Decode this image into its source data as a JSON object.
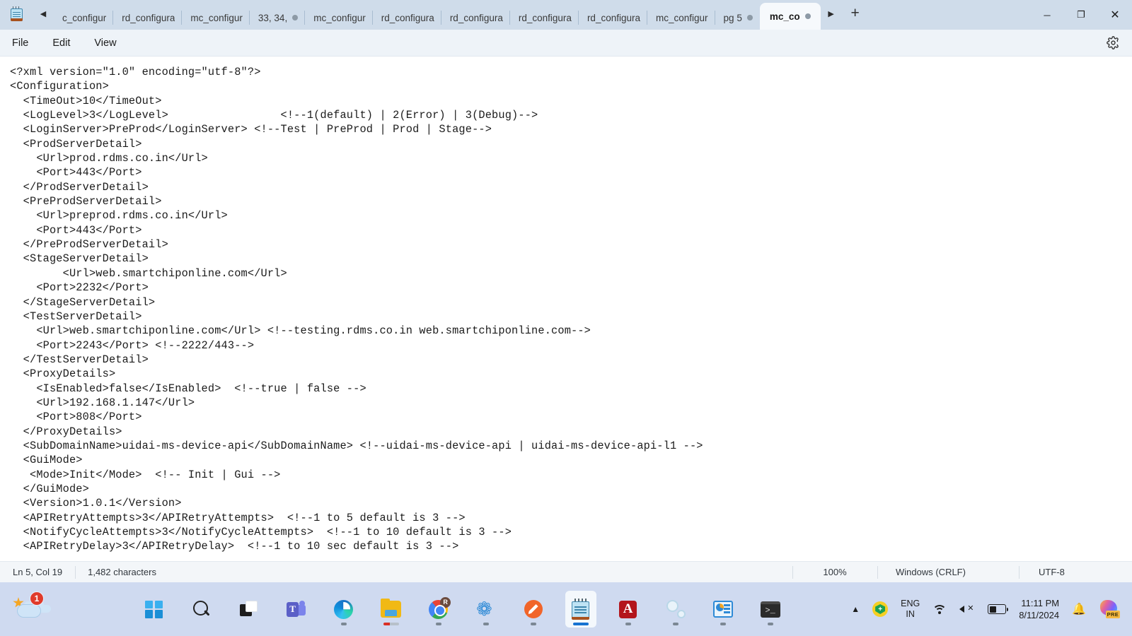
{
  "window": {
    "app_icon": "notepad-icon",
    "tabs": [
      {
        "label": "c_configur",
        "dot": false,
        "active": false
      },
      {
        "label": "rd_configura",
        "dot": false,
        "active": false
      },
      {
        "label": "mc_configur",
        "dot": false,
        "active": false
      },
      {
        "label": "33, 34,",
        "dot": true,
        "active": false
      },
      {
        "label": "mc_configur",
        "dot": false,
        "active": false
      },
      {
        "label": "rd_configura",
        "dot": false,
        "active": false
      },
      {
        "label": "rd_configura",
        "dot": false,
        "active": false
      },
      {
        "label": "rd_configura",
        "dot": false,
        "active": false
      },
      {
        "label": "rd_configura",
        "dot": false,
        "active": false
      },
      {
        "label": "mc_configur",
        "dot": false,
        "active": false
      },
      {
        "label": "pg 5",
        "dot": true,
        "active": false
      },
      {
        "label": "mc_co",
        "dot": true,
        "active": true
      }
    ],
    "scroll_left_icon": "caret-left-icon",
    "scroll_right_icon": "caret-right-icon",
    "new_tab_label": "+",
    "minimize_label": "─",
    "maximize_label": "❐",
    "close_label": "✕"
  },
  "menubar": {
    "items": [
      "File",
      "Edit",
      "View"
    ],
    "settings_icon": "gear-icon"
  },
  "editor": {
    "content": "<?xml version=\"1.0\" encoding=\"utf-8\"?>\n<Configuration>\n  <TimeOut>10</TimeOut>\n  <LogLevel>3</LogLevel>                 <!--1(default) | 2(Error) | 3(Debug)-->\n  <LoginServer>PreProd</LoginServer> <!--Test | PreProd | Prod | Stage-->\n  <ProdServerDetail>\n    <Url>prod.rdms.co.in</Url>\n    <Port>443</Port>\n  </ProdServerDetail>\n  <PreProdServerDetail>\n    <Url>preprod.rdms.co.in</Url>\n    <Port>443</Port>\n  </PreProdServerDetail>\n  <StageServerDetail>\n        <Url>web.smartchiponline.com</Url>\n    <Port>2232</Port>\n  </StageServerDetail>\n  <TestServerDetail>\n    <Url>web.smartchiponline.com</Url> <!--testing.rdms.co.in web.smartchiponline.com-->\n    <Port>2243</Port> <!--2222/443-->\n  </TestServerDetail>\n  <ProxyDetails>\n    <IsEnabled>false</IsEnabled>  <!--true | false -->\n    <Url>192.168.1.147</Url>\n    <Port>808</Port>\n  </ProxyDetails>\n  <SubDomainName>uidai-ms-device-api</SubDomainName> <!--uidai-ms-device-api | uidai-ms-device-api-l1 -->\n  <GuiMode>\n   <Mode>Init</Mode>  <!-- Init | Gui -->\n  </GuiMode>\n  <Version>1.0.1</Version>\n  <APIRetryAttempts>3</APIRetryAttempts>  <!--1 to 5 default is 3 -->\n  <NotifyCycleAttempts>3</NotifyCycleAttempts>  <!--1 to 10 default is 3 -->\n  <APIRetryDelay>3</APIRetryDelay>  <!--1 to 10 sec default is 3 -->"
  },
  "statusbar": {
    "position": "Ln 5, Col 19",
    "characters": "1,482 characters",
    "zoom": "100%",
    "line_ending": "Windows (CRLF)",
    "encoding": "UTF-8"
  },
  "taskbar": {
    "weather_badge": "1",
    "apps": [
      {
        "name": "start-button",
        "label": "Start"
      },
      {
        "name": "search-button",
        "label": "Search"
      },
      {
        "name": "task-view-button",
        "label": "Task View"
      },
      {
        "name": "teams-app",
        "label": "Microsoft Teams"
      },
      {
        "name": "edge-app",
        "label": "Microsoft Edge"
      },
      {
        "name": "file-explorer-app",
        "label": "File Explorer"
      },
      {
        "name": "chrome-app",
        "label": "Google Chrome"
      },
      {
        "name": "vscode-app",
        "label": "Visual Studio Code"
      },
      {
        "name": "postman-app",
        "label": "Postman"
      },
      {
        "name": "notepad-app",
        "label": "Notepad"
      },
      {
        "name": "acrobat-app",
        "label": "Adobe Acrobat"
      },
      {
        "name": "settings-gears-app",
        "label": "Settings"
      },
      {
        "name": "dashboard-app",
        "label": "Dashboard"
      },
      {
        "name": "terminal-app",
        "label": "Terminal"
      }
    ],
    "tray": {
      "overflow_icon": "chevron-up-icon",
      "shield_icon": "security-shield-icon",
      "language": "ENG",
      "region": "IN",
      "wifi_icon": "wifi-icon",
      "volume_icon": "volume-muted-icon",
      "battery_icon": "battery-icon",
      "time": "11:11 PM",
      "date": "8/11/2024",
      "bell_icon": "notification-bell-icon",
      "copilot_icon": "copilot-icon",
      "copilot_badge": "PRE"
    }
  },
  "colors": {
    "titlebar": "#cfdcea",
    "menubar": "#eef3f8",
    "taskbar": "#cfdaf0",
    "statusbar": "#f3f6f9",
    "editor_bg": "#ffffff",
    "text": "#1b1b1b"
  }
}
